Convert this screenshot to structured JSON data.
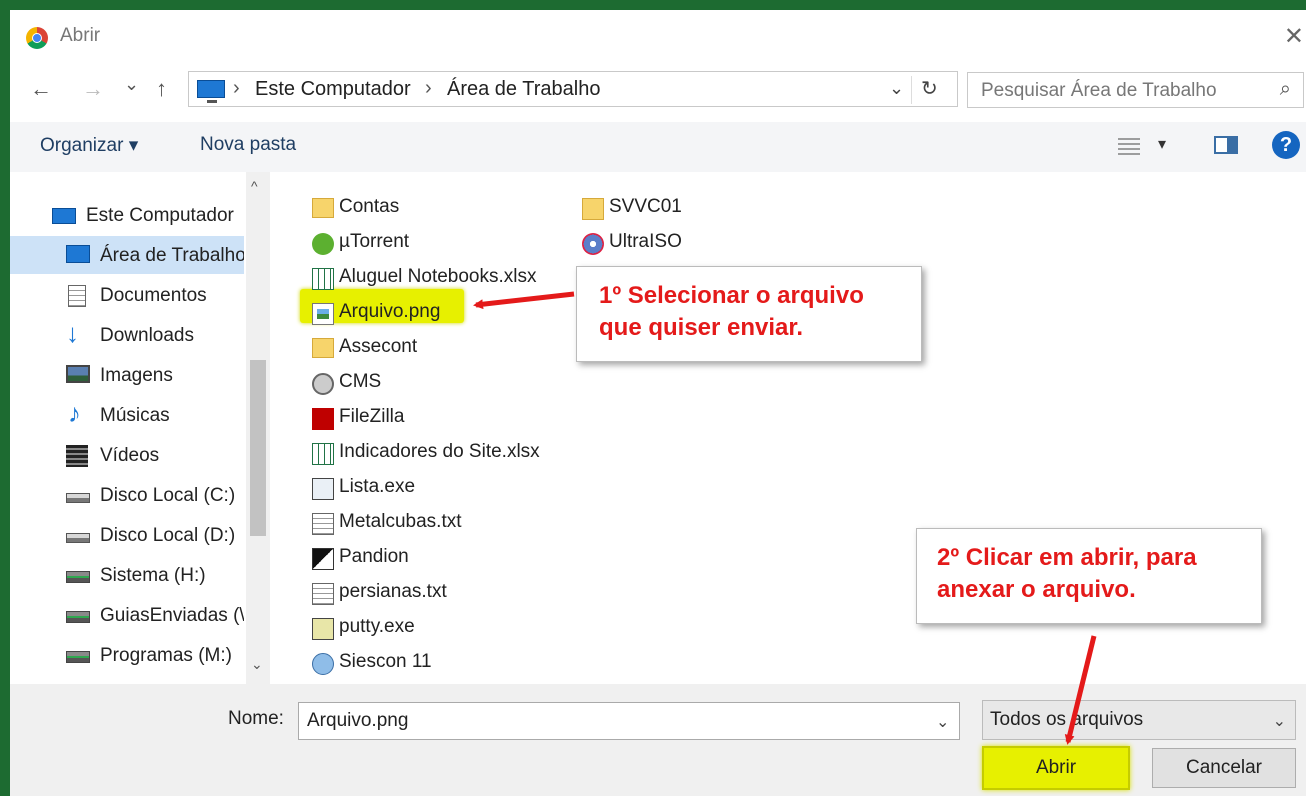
{
  "window": {
    "title": "Abrir",
    "close": "✕"
  },
  "nav_buttons": {
    "back": "←",
    "forward": "→",
    "recent": "⌄",
    "up": "↑"
  },
  "address": {
    "crumbs": [
      "Este Computador",
      "Área de Trabalho"
    ],
    "separator": "›",
    "dropdown": "⌄",
    "refresh": "↻"
  },
  "search": {
    "placeholder": "Pesquisar Área de Trabalho",
    "icon": "⌕"
  },
  "toolbar": {
    "organize": "Organizar ▾",
    "new_folder": "Nova pasta",
    "view_dropdown": "▾",
    "help": "?"
  },
  "sidebar": {
    "items": [
      {
        "label": "Este Computador",
        "icon": "computer-icon"
      },
      {
        "label": "Área de Trabalho",
        "icon": "desktop-icon",
        "selected": true
      },
      {
        "label": "Documentos",
        "icon": "documents-icon"
      },
      {
        "label": "Downloads",
        "icon": "download-icon"
      },
      {
        "label": "Imagens",
        "icon": "pictures-icon"
      },
      {
        "label": "Músicas",
        "icon": "music-icon"
      },
      {
        "label": "Vídeos",
        "icon": "videos-icon"
      },
      {
        "label": "Disco Local (C:)",
        "icon": "local-disk-icon"
      },
      {
        "label": "Disco Local (D:)",
        "icon": "local-disk-icon"
      },
      {
        "label": "Sistema (H:)",
        "icon": "network-drive-icon"
      },
      {
        "label": "GuiasEnviadas (\\",
        "icon": "network-drive-icon"
      },
      {
        "label": "Programas (M:)",
        "icon": "network-drive-icon"
      }
    ],
    "scroll_up": "^",
    "scroll_down": "⌄"
  },
  "files": {
    "column1": [
      {
        "label": "Contas",
        "icon": "folder-icon"
      },
      {
        "label": "µTorrent",
        "icon": "utorrent-icon"
      },
      {
        "label": "Aluguel Notebooks.xlsx",
        "icon": "excel-file-icon"
      },
      {
        "label": "Arquivo.png",
        "icon": "image-file-icon"
      },
      {
        "label": "Assecont",
        "icon": "folder-shortcut-icon"
      },
      {
        "label": "CMS",
        "icon": "cms-icon"
      },
      {
        "label": "FileZilla",
        "icon": "filezilla-icon"
      },
      {
        "label": "Indicadores do Site.xlsx",
        "icon": "excel-file-icon"
      },
      {
        "label": "Lista.exe",
        "icon": "exe-icon"
      },
      {
        "label": "Metalcubas.txt",
        "icon": "text-file-icon"
      },
      {
        "label": "Pandion",
        "icon": "pandion-icon"
      },
      {
        "label": "persianas.txt",
        "icon": "text-file-icon"
      },
      {
        "label": "putty.exe",
        "icon": "putty-icon"
      },
      {
        "label": "Siescon 11",
        "icon": "siescon-icon"
      }
    ],
    "column2": [
      {
        "label": "SVVC01",
        "icon": "folder-shortcut-icon"
      },
      {
        "label": "UltraISO",
        "icon": "ultraiso-icon"
      }
    ]
  },
  "annotations": {
    "step1": [
      "1º Selecionar o arquivo",
      "que quiser enviar."
    ],
    "step2": [
      "2º Clicar em abrir, para",
      "anexar o arquivo."
    ],
    "highlight_color": "#e7f000",
    "text_color": "#e41a1a"
  },
  "bottom": {
    "name_label": "Nome:",
    "name_value": "Arquivo.png",
    "name_dropdown": "⌄",
    "filter_value": "Todos os arquivos",
    "filter_dropdown": "⌄",
    "open_label": "Abrir",
    "cancel_label": "Cancelar"
  },
  "colors": {
    "background_frame": "#1d6b31",
    "selected_nav": "#cde2f7",
    "help_blue": "#1565c0"
  }
}
